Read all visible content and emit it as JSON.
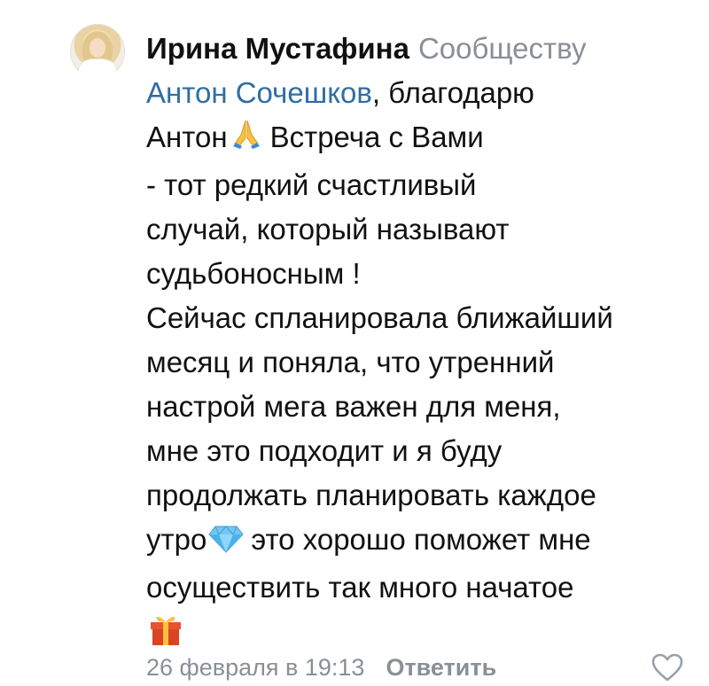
{
  "comment": {
    "author": "Ирина Мустафина",
    "target": "Сообществу",
    "mention": "Антон Сочешков",
    "text_lines": [
      ", благодарю",
      "Антон",
      "Встреча с Вами",
      "- тот редкий счастливый",
      "случай, который называют",
      "судьбоносным !",
      "Сейчас спланировала ближайший",
      "месяц и поняла, что утренний",
      "настрой мега важен для меня,",
      "мне это подходит и я буду",
      "продолжать планировать каждое",
      "утро",
      "это хорошо поможет мне",
      "осуществить так много начатое"
    ],
    "emojis": [
      "praying-hands",
      "diamond",
      "gift"
    ]
  },
  "footer": {
    "date": "26 февраля в 19:13",
    "reply_label": "Ответить"
  },
  "colors": {
    "mention": "#2f6ea5",
    "muted": "#8a8f96",
    "text": "#111111"
  }
}
